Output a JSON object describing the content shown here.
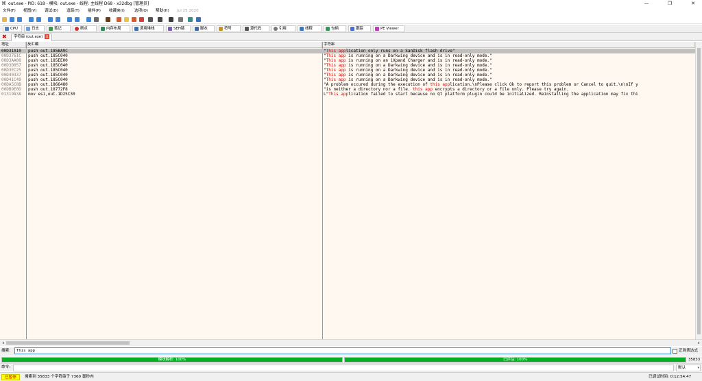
{
  "window": {
    "title": "out.exe - PID: 618 - 模块: out.exe - 线程: 主线程 D68 - x32dbg [管理员]",
    "minimize_glyph": "—",
    "maximize_glyph": "❐",
    "close_glyph": "✕"
  },
  "menu": {
    "items": [
      "文件(F)",
      "视图(V)",
      "调试(D)",
      "追踪(T)",
      "插件(P)",
      "收藏夹(I)",
      "选项(O)",
      "帮助(H)"
    ],
    "build_date": "Jul 25 2020"
  },
  "tabs": [
    {
      "label": "CPU",
      "color": "#4a7fc1"
    },
    {
      "label": "日志",
      "color": "#6f9fd8"
    },
    {
      "label": "笔记",
      "color": "#3a9a4a"
    },
    {
      "label": "断点",
      "color": "#d23030"
    },
    {
      "label": "内存布局",
      "color": "#2e8b57"
    },
    {
      "label": "调用堆栈",
      "color": "#3d6fb6"
    },
    {
      "label": "SEH链",
      "color": "#7a5fb0"
    },
    {
      "label": "脚本",
      "color": "#3e6aa8"
    },
    {
      "label": "符号",
      "color": "#c4932a"
    },
    {
      "label": "源代码",
      "color": "#555555"
    },
    {
      "label": "引用",
      "color": "#777777"
    },
    {
      "label": "线程",
      "color": "#3b78c4"
    },
    {
      "label": "句柄",
      "color": "#2f9a5a"
    },
    {
      "label": "跟踪",
      "color": "#4a6fd0"
    },
    {
      "label": "PE Viewer",
      "color": "#c03ac0"
    }
  ],
  "reference_tab": {
    "label": "字符串 (out.exe)",
    "close_glyph": "x",
    "panel_close_glyph": "✖"
  },
  "grid": {
    "columns": [
      "地址",
      "反汇编",
      "字符串"
    ],
    "rows": [
      {
        "addr": "00D31A10",
        "dis": "push out.185BA9C",
        "pre": "\"",
        "hl": "This app",
        "post": "lication only runs on a SanDisk flash drive\"",
        "selected": true
      },
      {
        "addr": "00D3761C",
        "dis": "push out.185C040",
        "pre": "\"",
        "hl": "This app",
        "post": " is running on a Darkwing device and is in read-only mode.\"",
        "selected": false
      },
      {
        "addr": "00D3AA08",
        "dis": "push out.185EE00",
        "pre": "\"",
        "hl": "This app",
        "post": " is running on an iXpand Charger and is in read-only mode.\"",
        "selected": false
      },
      {
        "addr": "00D3D057",
        "dis": "push out.185C040",
        "pre": "\"",
        "hl": "This app",
        "post": " is running on a Darkwing device and is in read-only mode.\"",
        "selected": false
      },
      {
        "addr": "00D3EC25",
        "dis": "push out.185C040",
        "pre": "\"",
        "hl": "This app",
        "post": " is running on a Darkwing device and is in read-only mode.\"",
        "selected": false
      },
      {
        "addr": "00D40337",
        "dis": "push out.185C040",
        "pre": "\"",
        "hl": "This app",
        "post": " is running on a Darkwing device and is in read-only mode.\"",
        "selected": false
      },
      {
        "addr": "00D41C49",
        "dis": "push out.185C040",
        "pre": "\"",
        "hl": "This app",
        "post": " is running on a Darkwing device and is in read-only mode.\"",
        "selected": false
      },
      {
        "addr": "00DA5C8B",
        "dis": "push out.1866480",
        "pre": "\"A problem occured during the execution of ",
        "hl": "this app",
        "post": "lication.\\nPlease click Ok to report this problem or Cancel to quit.\\n\\nIf y",
        "selected": false
      },
      {
        "addr": "00DB9E0D",
        "dis": "push out.18772F8",
        "pre": "\"is neither a directory nor a file. ",
        "hl": "this app",
        "post": " encrypts a directory or a file only. Please try again.",
        "selected": false
      },
      {
        "addr": "01319A3A",
        "dis": "mov esi,out.1D25C30",
        "pre": "L\"",
        "hl": "This app",
        "post": "lication failed to start because no Qt platform plugin could be initialized. Reinstalling the application may fix thi",
        "selected": false
      }
    ]
  },
  "search": {
    "label": "搜索:",
    "value": "This app",
    "regex_label": "正则表达式"
  },
  "progress": {
    "left_text": "模块解析: 100%",
    "right_text": "已评估: 100%",
    "left_fraction": 1.0,
    "right_fraction": 1.0,
    "count": "35833"
  },
  "command": {
    "label": "命令:",
    "select_value": "默认"
  },
  "status": {
    "state": "已暂停",
    "message": "搜索到 35833 个字符串于 7360 毫秒内",
    "timer": "已调试时间: 0:12:54:47"
  },
  "colors": {
    "highlight": "#e00000",
    "progress_green": "#06b025",
    "paused_bg": "#ffff00",
    "grid_bg": "#fff8f0",
    "selected_row": "#c0c0c0"
  }
}
